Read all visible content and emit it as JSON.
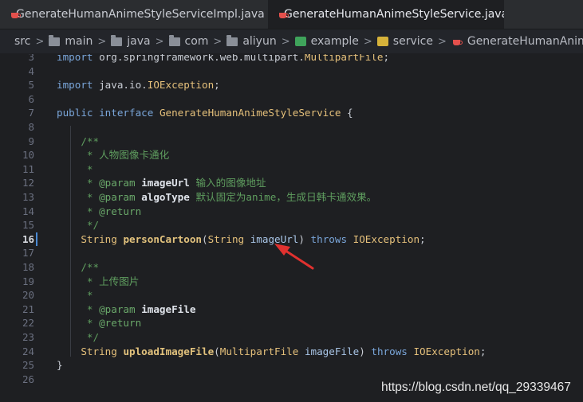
{
  "tabs": [
    {
      "label": "GenerateHumanAnimeStyleServiceImpl.java",
      "active": false
    },
    {
      "label": "GenerateHumanAnimeStyleService.java",
      "active": true
    },
    {
      "label": "",
      "active": false
    }
  ],
  "breadcrumbs": [
    "src",
    "main",
    "java",
    "com",
    "aliyun",
    "example",
    "service",
    "GenerateHumanAnimeStyleService"
  ],
  "lines": [
    {
      "n": "3",
      "code": "import org.springframework.web.multipart.MultipartFile;"
    },
    {
      "n": "4",
      "code": ""
    },
    {
      "n": "5",
      "code": "import java.io.IOException;"
    },
    {
      "n": "6",
      "code": ""
    },
    {
      "n": "7",
      "code": "public interface GenerateHumanAnimeStyleService {"
    },
    {
      "n": "8",
      "code": ""
    },
    {
      "n": "9",
      "code": "    /**"
    },
    {
      "n": "10",
      "code": "     * 人物图像卡通化"
    },
    {
      "n": "11",
      "code": "     *"
    },
    {
      "n": "12",
      "code": "     * @param imageUrl 输入的图像地址"
    },
    {
      "n": "13",
      "code": "     * @param algoType 默认固定为anime，生成日韩卡通效果。"
    },
    {
      "n": "14",
      "code": "     * @return"
    },
    {
      "n": "15",
      "code": "     */"
    },
    {
      "n": "16",
      "code": "    String personCartoon(String imageUrl) throws IOException;"
    },
    {
      "n": "17",
      "code": ""
    },
    {
      "n": "18",
      "code": "    /**"
    },
    {
      "n": "19",
      "code": "     * 上传图片"
    },
    {
      "n": "20",
      "code": "     *"
    },
    {
      "n": "21",
      "code": "     * @param imageFile"
    },
    {
      "n": "22",
      "code": "     * @return"
    },
    {
      "n": "23",
      "code": "     */"
    },
    {
      "n": "24",
      "code": "    String uploadImageFile(MultipartFile imageFile) throws IOException;"
    },
    {
      "n": "25",
      "code": "}"
    },
    {
      "n": "26",
      "code": ""
    }
  ],
  "current_line": "16",
  "watermark": "https://blog.csdn.net/qq_29339467",
  "colors": {
    "keyword": "#7aa6da",
    "type": "#e5c07b",
    "comment": "#5f9e5f",
    "arrow": "#e0312f",
    "current_line_bar": "#4a8ad4"
  }
}
